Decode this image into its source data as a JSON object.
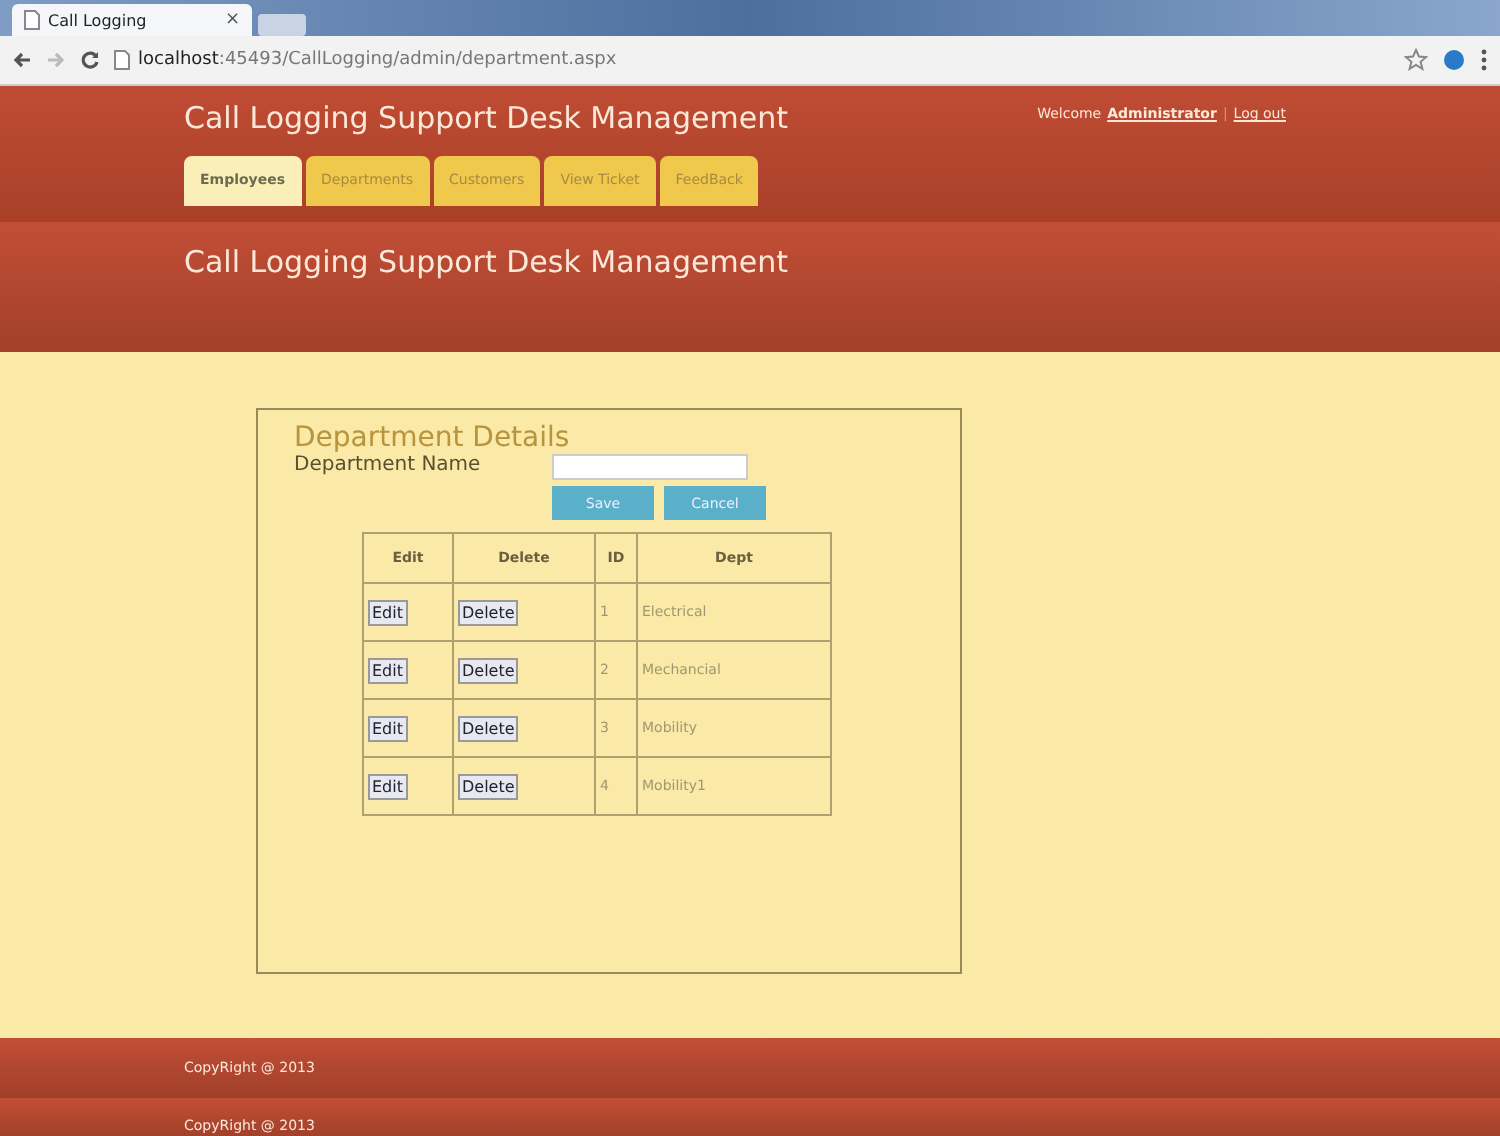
{
  "browser": {
    "tab_title": "Call Logging",
    "tab_close": "×",
    "url_host": "localhost",
    "url_path": ":45493/CallLogging/admin/department.aspx"
  },
  "header": {
    "title": "Call Logging Support Desk Management",
    "welcome": "Welcome",
    "user": "Administrator",
    "separator": "|",
    "logout": "Log out"
  },
  "tabs": [
    {
      "label": "Employees",
      "selected": true
    },
    {
      "label": "Departments",
      "selected": false
    },
    {
      "label": "Customers",
      "selected": false
    },
    {
      "label": "View Ticket",
      "selected": false
    },
    {
      "label": "FeedBack",
      "selected": false
    }
  ],
  "banner": {
    "title": "Call Logging Support Desk Management"
  },
  "form": {
    "heading": "Department Details",
    "field_label": "Department Name",
    "save": "Save",
    "cancel": "Cancel"
  },
  "table": {
    "columns": [
      "Edit",
      "Delete",
      "ID",
      "Dept"
    ],
    "rows": [
      {
        "edit": "Edit",
        "delete": "Delete",
        "id": "1",
        "dept": "Electrical"
      },
      {
        "edit": "Edit",
        "delete": "Delete",
        "id": "2",
        "dept": "Mechancial"
      },
      {
        "edit": "Edit",
        "delete": "Delete",
        "id": "3",
        "dept": "Mobility"
      },
      {
        "edit": "Edit",
        "delete": "Delete",
        "id": "4",
        "dept": "Mobility1"
      }
    ]
  },
  "footer": [
    "CopyRight @ 2013",
    "CopyRight @ 2013"
  ]
}
